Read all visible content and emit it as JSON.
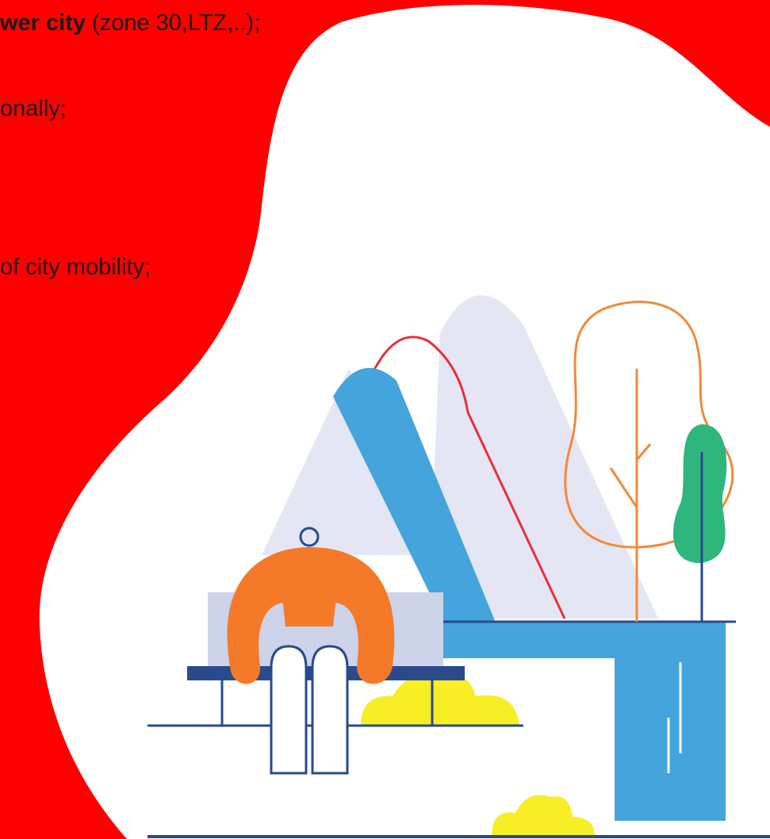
{
  "text_lines": {
    "line1_bold": "wer city",
    "line1_rest": " (zone 30,LTZ,..);",
    "line2": "onally;",
    "line3": "of city mobility;"
  },
  "colors": {
    "background_accent": "#ff0000",
    "page_background": "#ffffff",
    "text": "#1a1a1a",
    "person_orange": "#f47a2a",
    "slide_blue": "#44a4db",
    "mountain_lavender": "#e4e6f3",
    "bench_navy": "#2a4a8c",
    "tree_green": "#2eb67d",
    "bush_yellow": "#f7ee26",
    "wire_red": "#e8303a",
    "outline_tree_orange": "#f08a3a"
  },
  "icons": {
    "illustration": "person-sitting-on-bench-park-illustration"
  }
}
